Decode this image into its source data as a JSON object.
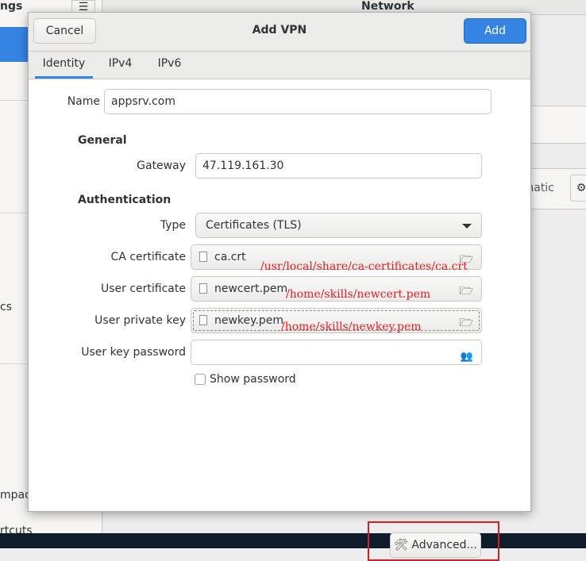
{
  "background": {
    "sidebar_title": "ngs",
    "menu_icon": "hamburger-menu-icon",
    "network_title": "Network",
    "sidebar_partial_items": [
      "cs",
      "mpad",
      "rtcuts"
    ],
    "automatic_text": "omatic",
    "gear_icon": "gear-icon",
    "selected_color": "#3584e4"
  },
  "dialog": {
    "title": "Add VPN",
    "cancel_label": "Cancel",
    "add_label": "Add",
    "tabs": [
      {
        "label": "Identity",
        "active": true
      },
      {
        "label": "IPv4",
        "active": false
      },
      {
        "label": "IPv6",
        "active": false
      }
    ],
    "name": {
      "label": "Name",
      "value": "appsrv.com"
    },
    "general": {
      "heading": "General",
      "gateway_label": "Gateway",
      "gateway_value": "47.119.161.30"
    },
    "authentication": {
      "heading": "Authentication",
      "type_label": "Type",
      "type_value": "Certificates (TLS)",
      "ca_label": "CA certificate",
      "ca_file": "ca.crt",
      "user_cert_label": "User certificate",
      "user_cert_file": "newcert.pem",
      "user_key_label": "User private key",
      "user_key_file": "newkey.pem",
      "key_password_label": "User key password",
      "key_password_value": "",
      "show_password_label": "Show password",
      "show_password_checked": false
    },
    "advanced_label": "Advanced..."
  },
  "annotations": {
    "ca_path": "/usr/local/share/ca-certificates/ca.crt",
    "cert_path": "/home/skills/newcert.pem",
    "key_path": "/home/skills/newkey.pem",
    "color": "#e02020"
  }
}
